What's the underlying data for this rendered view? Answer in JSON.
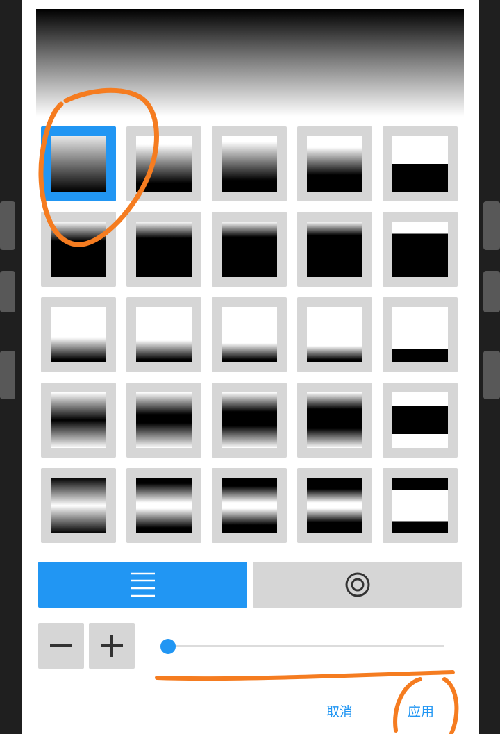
{
  "dialog": {
    "accent_color": "#2196f3",
    "preview": {
      "description_icon": "gradient-preview"
    },
    "presets": [
      {
        "row": 1,
        "items": [
          "linear-soft",
          "linear-top-fade-1",
          "linear-top-fade-2",
          "linear-top-fade-3",
          "hard-split-lower"
        ]
      },
      {
        "row": 2,
        "items": [
          "short-fade-1",
          "short-fade-2",
          "short-fade-3",
          "short-fade-4",
          "hard-split-upper"
        ]
      },
      {
        "row": 3,
        "items": [
          "bottom-fade-1",
          "bottom-fade-2",
          "bottom-fade-3",
          "bottom-fade-4",
          "bottom-bar"
        ]
      },
      {
        "row": 4,
        "items": [
          "center-band-1",
          "center-band-2",
          "center-band-3",
          "center-band-4",
          "center-bar"
        ]
      },
      {
        "row": 5,
        "items": [
          "double-band-1",
          "double-band-2",
          "double-band-3",
          "double-band-4",
          "double-bar"
        ]
      }
    ],
    "selected_preset": "linear-soft",
    "mode_buttons": [
      {
        "icon": "lines-icon",
        "selected": true
      },
      {
        "icon": "concentric-circles-icon",
        "selected": false
      }
    ],
    "stepper": {
      "minus_icon": "minus-icon",
      "plus_icon": "plus-icon"
    },
    "slider": {
      "value_fraction": 0.0
    },
    "actions": {
      "cancel_label": "取消",
      "apply_label": "应用"
    }
  }
}
